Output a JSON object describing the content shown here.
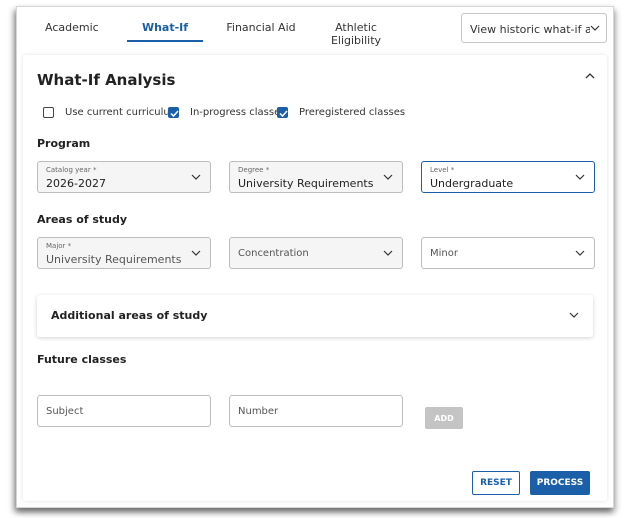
{
  "tabs": [
    {
      "label": "Academic",
      "active": false
    },
    {
      "label": "What-If",
      "active": true
    },
    {
      "label": "Financial Aid",
      "active": false
    },
    {
      "label": "Athletic Eligibility",
      "active": false
    }
  ],
  "history_select": {
    "value": "View historic what-if audits"
  },
  "panel": {
    "title": "What-If Analysis",
    "options": [
      {
        "label": "Use current curriculum",
        "checked": false
      },
      {
        "label": "In-progress classes",
        "checked": true
      },
      {
        "label": "Preregistered classes",
        "checked": true
      }
    ]
  },
  "program": {
    "heading": "Program",
    "catalog_year": {
      "label": "Catalog year *",
      "value": "2026-2027"
    },
    "degree": {
      "label": "Degree *",
      "value": "University Requirements"
    },
    "level": {
      "label": "Level *",
      "value": "Undergraduate"
    }
  },
  "areas": {
    "heading": "Areas of study",
    "major": {
      "label": "Major *",
      "value": "University Requirements"
    },
    "concentration": {
      "placeholder": "Concentration"
    },
    "minor": {
      "placeholder": "Minor"
    },
    "additional": "Additional areas of study"
  },
  "future": {
    "heading": "Future classes",
    "subject_placeholder": "Subject",
    "number_placeholder": "Number",
    "add_label": "ADD"
  },
  "actions": {
    "reset": "RESET",
    "process": "PROCESS"
  },
  "colors": {
    "accent": "#1a5fa8",
    "disabled": "#c4c4c4"
  }
}
